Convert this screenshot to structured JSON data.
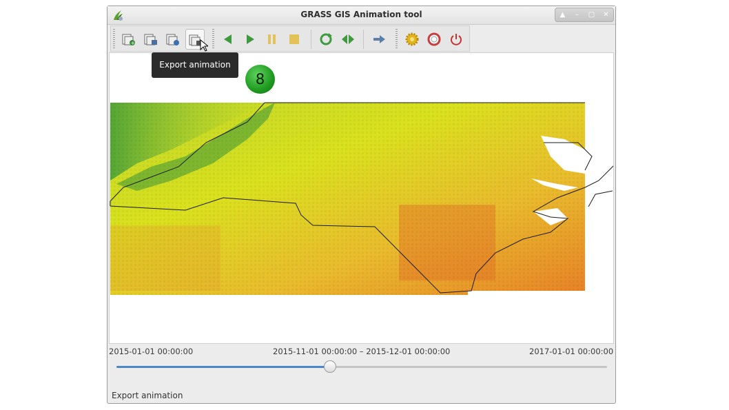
{
  "window": {
    "title": "GRASS GIS Animation tool"
  },
  "toolbar": {
    "buttons": [
      {
        "name": "add-animation",
        "icon": "add-layer-icon"
      },
      {
        "name": "edit-animation",
        "icon": "edit-layer-icon"
      },
      {
        "name": "reload-animation",
        "icon": "reload-layer-icon"
      },
      {
        "name": "export-animation",
        "icon": "export-icon",
        "active": true
      },
      {
        "name": "play-back",
        "icon": "play-back-icon"
      },
      {
        "name": "play",
        "icon": "play-icon"
      },
      {
        "name": "pause",
        "icon": "pause-icon"
      },
      {
        "name": "stop",
        "icon": "stop-icon"
      },
      {
        "name": "loop",
        "icon": "loop-icon"
      },
      {
        "name": "back-and-forth",
        "icon": "back-forth-icon"
      },
      {
        "name": "speed",
        "icon": "arrow-right-icon"
      },
      {
        "name": "settings",
        "icon": "gear-icon"
      },
      {
        "name": "help",
        "icon": "lifebuoy-icon"
      },
      {
        "name": "quit",
        "icon": "power-icon"
      }
    ]
  },
  "tooltip": {
    "text": "Export animation"
  },
  "badge": {
    "text": "8"
  },
  "timeline": {
    "start": "2015-01-01 00:00:00",
    "current": "2015-11-01 00:00:00 – 2015-12-01 00:00:00",
    "end": "2017-01-01 00:00:00",
    "position_fraction": 0.435
  },
  "status": {
    "text": "Export animation"
  },
  "colors": {
    "slider_fill": "#4a86c8",
    "accent_green": "#1f9a1f",
    "map_low": "#e87a18",
    "map_high": "#2f8f2f"
  }
}
